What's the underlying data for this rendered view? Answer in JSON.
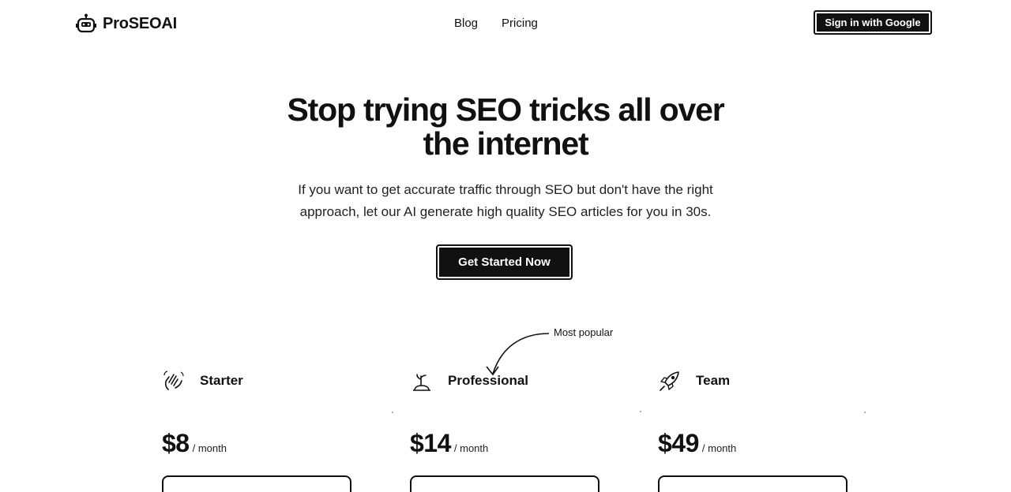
{
  "header": {
    "brand": "ProSEOAI",
    "nav": [
      {
        "label": "Blog"
      },
      {
        "label": "Pricing"
      }
    ],
    "signin_label": "Sign in with Google"
  },
  "hero": {
    "title_line1": "Stop trying SEO tricks all over",
    "title_line2": "the internet",
    "subtitle_line1": "If you want to get accurate traffic through SEO but don't have the right",
    "subtitle_line2": "approach, let our AI generate high quality SEO articles for you in 30s.",
    "cta_label": "Get Started Now"
  },
  "pricing": {
    "popular_label": "Most popular",
    "plans": [
      {
        "name": "Starter",
        "icon": "waving-hand-icon",
        "price": "$8",
        "period": "/ month"
      },
      {
        "name": "Professional",
        "icon": "seedling-icon",
        "price": "$14",
        "period": "/ month"
      },
      {
        "name": "Team",
        "icon": "rocket-icon",
        "price": "$49",
        "period": "/ month"
      }
    ]
  }
}
